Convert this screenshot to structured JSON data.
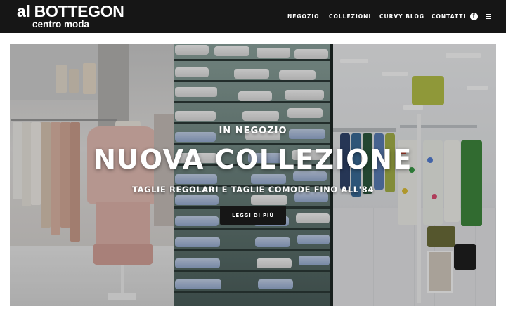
{
  "brand": {
    "name": "al BOTTEGON",
    "tagline": "centro moda"
  },
  "nav": {
    "items": [
      {
        "label": "NEGOZIO"
      },
      {
        "label": "COLLEZIONI"
      },
      {
        "label": "CURVY BLOG"
      },
      {
        "label": "CONTATTI"
      }
    ],
    "social_icon": "facebook-icon",
    "social_glyph": "f",
    "menu_icon": "hamburger-menu-icon"
  },
  "hero": {
    "subtitle": "IN NEGOZIO",
    "title": "NUOVA COLLEZIONE",
    "tagline": "TAGLIE REGOLARI E TAGLIE COMODE FINO ALL'84",
    "button_label": "LEGGI DI PIÙ"
  },
  "colors": {
    "header_bg": "#161616",
    "text_light": "#ffffff",
    "button_bg": "#161616"
  }
}
